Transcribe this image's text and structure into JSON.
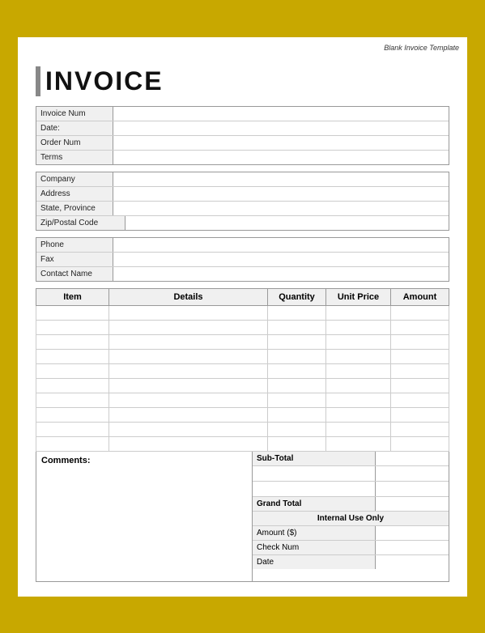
{
  "template": {
    "label": "Blank Invoice Template"
  },
  "header": {
    "title": "INVOICE"
  },
  "invoice_info": {
    "fields": [
      {
        "label": "Invoice Num"
      },
      {
        "label": "Date:"
      },
      {
        "label": "Order Num"
      },
      {
        "label": "Terms"
      }
    ]
  },
  "company_info": {
    "fields": [
      {
        "label": "Company"
      },
      {
        "label": "Address"
      },
      {
        "label": "State, Province"
      },
      {
        "label": "Zip/Postal Code"
      }
    ]
  },
  "contact_info": {
    "fields": [
      {
        "label": "Phone"
      },
      {
        "label": "Fax"
      },
      {
        "label": "Contact Name"
      }
    ]
  },
  "table": {
    "headers": {
      "item": "Item",
      "details": "Details",
      "quantity": "Quantity",
      "unit_price": "Unit Price",
      "amount": "Amount"
    },
    "rows": 10
  },
  "comments": {
    "label": "Comments:"
  },
  "totals": {
    "sub_total": "Sub-Total",
    "spacer1": "",
    "spacer2": "",
    "grand_total": "Grand Total",
    "internal_use": "Internal Use Only",
    "amount_s": "Amount ($)",
    "check_num": "Check Num",
    "date": "Date"
  }
}
